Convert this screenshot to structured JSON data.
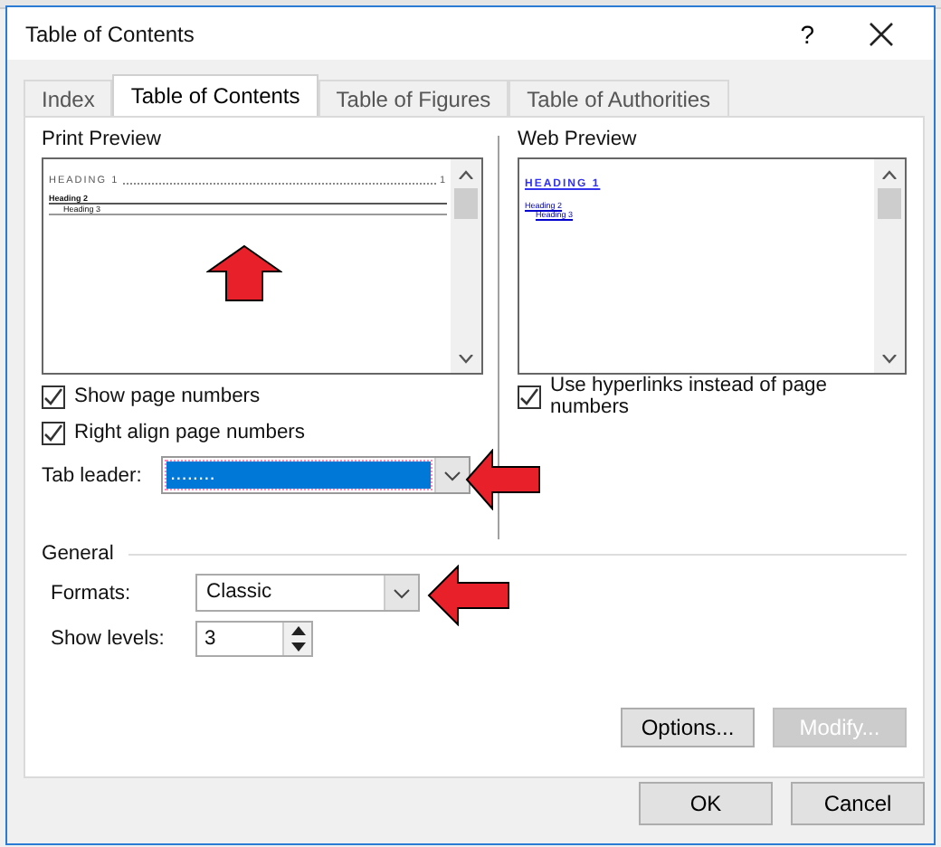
{
  "window": {
    "title": "Table of Contents",
    "help": "?"
  },
  "tabs": [
    {
      "label": "Index",
      "selected": false
    },
    {
      "label": "Table of Contents",
      "selected": true
    },
    {
      "label": "Table of Figures",
      "selected": false
    },
    {
      "label": "Table of Authorities",
      "selected": false
    }
  ],
  "print_preview": {
    "label": "Print Preview",
    "heading_1": "HEADING 1",
    "page_number": "1",
    "heading_2": "Heading 2",
    "heading_3": "Heading 3"
  },
  "print_options": [
    {
      "label": "Show page numbers",
      "checked": true
    },
    {
      "label": "Right align page numbers",
      "checked": true
    }
  ],
  "tab_leader": {
    "label": "Tab leader:",
    "value": "........"
  },
  "web_preview": {
    "label": "Web Preview",
    "heading_1": "HEADING 1",
    "heading_2": "Heading 2",
    "heading_3": "Heading 3"
  },
  "web_options": [
    {
      "label": "Use hyperlinks instead of page numbers",
      "checked": true
    }
  ],
  "general": {
    "title": "General",
    "formats": {
      "label": "Formats:",
      "value": "Classic"
    },
    "show_levels": {
      "label": "Show levels:",
      "value": "3"
    }
  },
  "panel_buttons": [
    {
      "label": "Options...",
      "disabled": false
    },
    {
      "label": "Modify...",
      "disabled": true
    }
  ],
  "buttons": [
    {
      "label": "OK",
      "disabled": false
    },
    {
      "label": "Cancel",
      "disabled": false
    }
  ]
}
